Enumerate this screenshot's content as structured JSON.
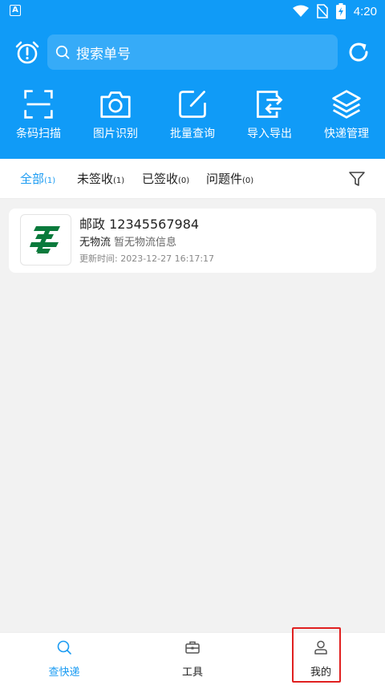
{
  "status_bar": {
    "app_badge": "A",
    "time": "4:20",
    "icons": [
      "wifi-icon",
      "no-sim-icon",
      "battery-charging-icon"
    ]
  },
  "header": {
    "search": {
      "placeholder": "搜索单号",
      "icon": "search-icon"
    },
    "left_icon": "alarm-clock-icon",
    "right_icon": "refresh-icon",
    "tools": [
      {
        "label": "条码扫描",
        "icon": "scan-frame-icon"
      },
      {
        "label": "图片识别",
        "icon": "camera-icon"
      },
      {
        "label": "批量查询",
        "icon": "edit-icon"
      },
      {
        "label": "导入导出",
        "icon": "import-export-icon"
      },
      {
        "label": "快递管理",
        "icon": "layers-icon"
      }
    ]
  },
  "tabs": [
    {
      "label": "全部",
      "count": "(1)",
      "active": true
    },
    {
      "label": "未签收",
      "count": "(1)",
      "active": false
    },
    {
      "label": "已签收",
      "count": "(0)",
      "active": false
    },
    {
      "label": "问题件",
      "count": "(0)",
      "active": false
    }
  ],
  "parcel": {
    "title": "邮政 12345567984",
    "status": "无物流",
    "detail": "暂无物流信息",
    "updated": "更新时间: 2023-12-27 16:17:17",
    "logo_icon": "china-post-logo"
  },
  "bottom_nav": [
    {
      "label": "查快递",
      "icon": "search-icon",
      "active": true
    },
    {
      "label": "工具",
      "icon": "toolbox-icon",
      "active": false
    },
    {
      "label": "我的",
      "icon": "user-icon",
      "active": false
    }
  ],
  "colors": {
    "primary": "#109bf7",
    "active_text": "#1a9bf2",
    "brand_green": "#0a7a3c",
    "highlight": "#e02020"
  }
}
